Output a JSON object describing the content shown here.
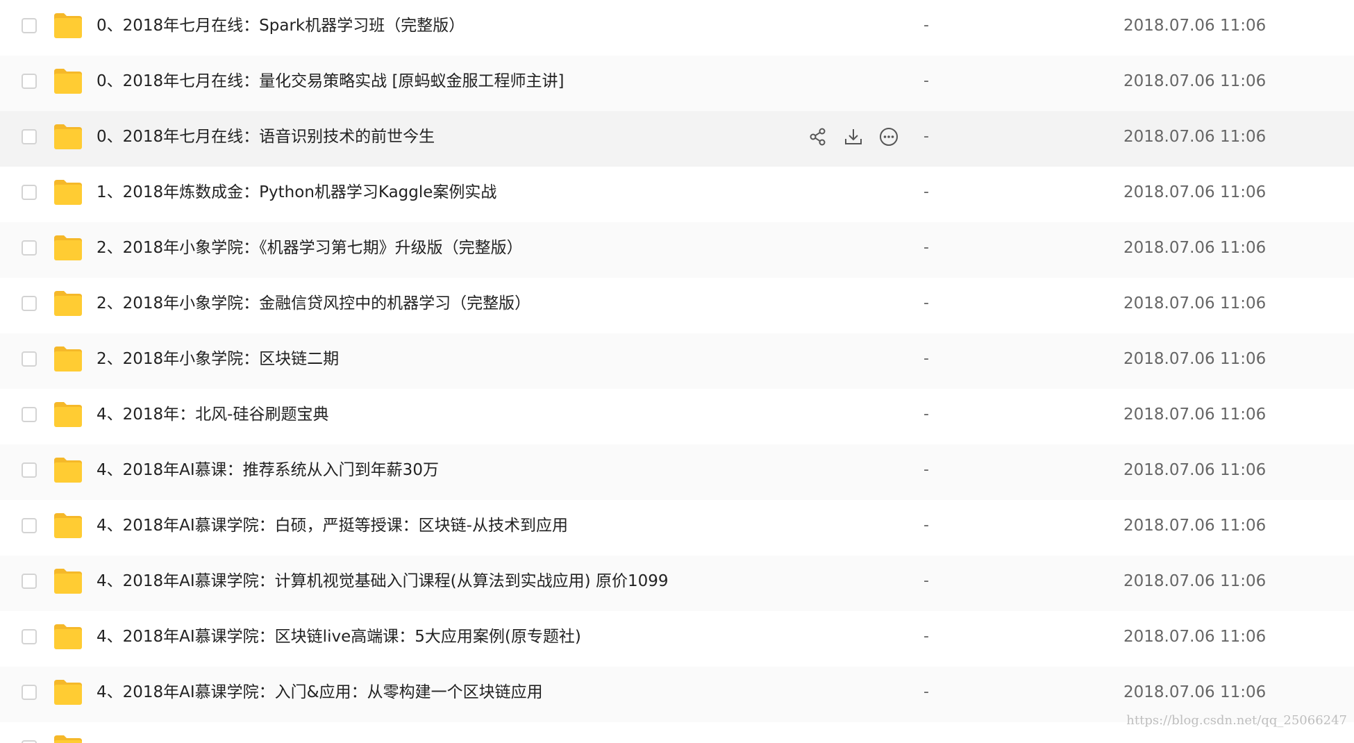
{
  "files": [
    {
      "name": "0、2018年七月在线：Spark机器学习班（完整版）",
      "size": "-",
      "modified": "2018.07.06 11:06"
    },
    {
      "name": "0、2018年七月在线：量化交易策略实战 [原蚂蚁金服工程师主讲]",
      "size": "-",
      "modified": "2018.07.06 11:06"
    },
    {
      "name": "0、2018年七月在线：语音识别技术的前世今生",
      "size": "-",
      "modified": "2018.07.06 11:06"
    },
    {
      "name": "1、2018年炼数成金：Python机器学习Kaggle案例实战",
      "size": "-",
      "modified": "2018.07.06 11:06"
    },
    {
      "name": "2、2018年小象学院：《机器学习第七期》升级版（完整版）",
      "size": "-",
      "modified": "2018.07.06 11:06"
    },
    {
      "name": "2、2018年小象学院：金融信贷风控中的机器学习（完整版）",
      "size": "-",
      "modified": "2018.07.06 11:06"
    },
    {
      "name": "2、2018年小象学院：区块链二期",
      "size": "-",
      "modified": "2018.07.06 11:06"
    },
    {
      "name": "4、2018年：北风-硅谷刷题宝典",
      "size": "-",
      "modified": "2018.07.06 11:06"
    },
    {
      "name": "4、2018年AI慕课：推荐系统从入门到年薪30万",
      "size": "-",
      "modified": "2018.07.06 11:06"
    },
    {
      "name": "4、2018年AI慕课学院：白硕，严挺等授课：区块链-从技术到应用",
      "size": "-",
      "modified": "2018.07.06 11:06"
    },
    {
      "name": "4、2018年AI慕课学院：计算机视觉基础入门课程(从算法到实战应用) 原价1099",
      "size": "-",
      "modified": "2018.07.06 11:06"
    },
    {
      "name": "4、2018年AI慕课学院：区块链live高端课：5大应用案例(原专题社)",
      "size": "-",
      "modified": "2018.07.06 11:06"
    },
    {
      "name": "4、2018年AI慕课学院：入门&应用：从零构建一个区块链应用",
      "size": "-",
      "modified": "2018.07.06 11:06"
    }
  ],
  "hover_actions": {
    "share_icon": "share-icon",
    "download_icon": "download-icon",
    "more_icon": "more-icon"
  },
  "colors": {
    "folder": "#ffcc33",
    "folder_tab": "#f5b829",
    "hover_row": "#f3f3f3",
    "alt_row": "#fafafa"
  },
  "watermark": "https://blog.csdn.net/qq_25066247"
}
